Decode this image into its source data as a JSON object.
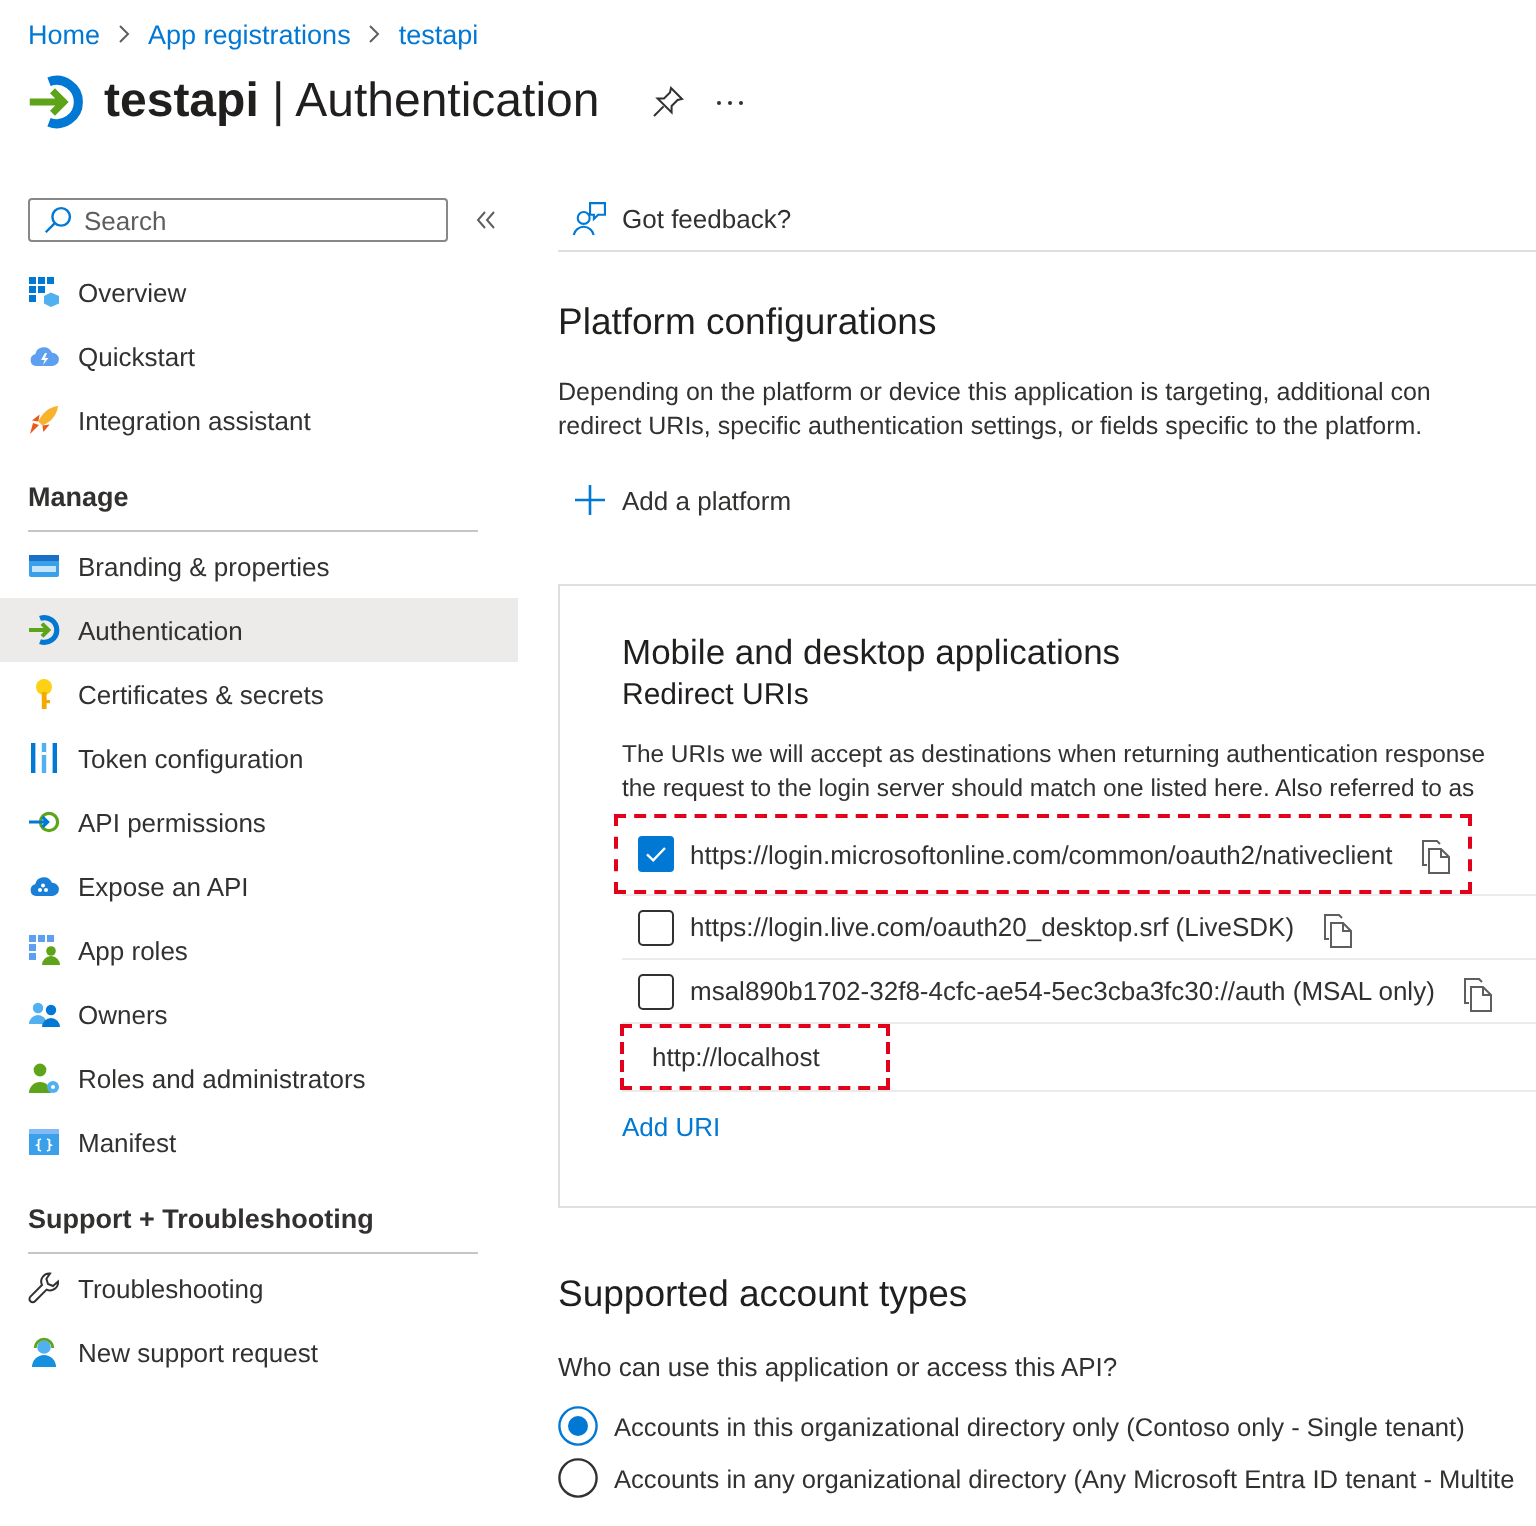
{
  "breadcrumb": [
    {
      "label": "Home"
    },
    {
      "label": "App registrations"
    },
    {
      "label": "testapi"
    }
  ],
  "page_title": "**testapi** | Authentication",
  "sidebar": {
    "search": {
      "placeholder": "Search"
    },
    "sections": [
      {
        "items": [
          {
            "label": "Overview",
            "selected": false
          },
          {
            "label": "Quickstart",
            "selected": false
          },
          {
            "label": "Integration assistant",
            "selected": false
          }
        ]
      },
      {
        "heading": "Manage",
        "items": [
          {
            "label": "Branding & properties",
            "selected": false
          },
          {
            "label": "Authentication",
            "selected": true
          },
          {
            "label": "Certificates & secrets",
            "selected": false
          },
          {
            "label": "Token configuration",
            "selected": false
          },
          {
            "label": "API permissions",
            "selected": false
          },
          {
            "label": "Expose an API",
            "selected": false
          },
          {
            "label": "App roles",
            "selected": false
          },
          {
            "label": "Owners",
            "selected": false
          },
          {
            "label": "Roles and administrators",
            "selected": false
          },
          {
            "label": "Manifest",
            "selected": false
          }
        ]
      },
      {
        "heading": "Support + Troubleshooting",
        "items": [
          {
            "label": "Troubleshooting",
            "selected": false
          },
          {
            "label": "New support request",
            "selected": false
          }
        ]
      }
    ]
  },
  "toolbar": {
    "feedback_button": "Got feedback?"
  },
  "platform_configurations": {
    "title": "Platform configurations",
    "description_lines": [
      "Depending on the platform or device this application is targeting, additional con",
      "redirect URIs, specific authentication settings, or fields specific to the platform."
    ],
    "add_button": "Add a platform",
    "card": {
      "title": "Mobile and desktop applications",
      "subtitle": "Redirect URIs",
      "description_lines": [
        "The URIs we will accept as destinations when returning authentication response",
        "the request to the login server should match one listed here. Also referred to as"
      ],
      "uris": [
        {
          "kind": "suggested",
          "text": "https://login.microsoftonline.com/common/oauth2/nativeclient",
          "checked": true,
          "highlighted": true
        },
        {
          "kind": "suggested",
          "text": "https://login.live.com/oauth20_desktop.srf (LiveSDK)",
          "checked": false,
          "highlighted": false
        },
        {
          "kind": "suggested",
          "text": "msal890b1702-32f8-4cfc-ae54-5ec3cba3fc30://auth (MSAL only)",
          "checked": false,
          "highlighted": false
        },
        {
          "kind": "custom",
          "value": "http://localhost",
          "highlighted": true
        }
      ],
      "add_link": "Add URI"
    }
  },
  "supported_account_types": {
    "title": "Supported account types",
    "question": "Who can use this application or access this API?",
    "options": [
      {
        "label": "Accounts in this organizational directory only (Contoso only - Single tenant)",
        "selected": true
      },
      {
        "label": "Accounts in any organizational directory (Any Microsoft Entra ID tenant - Multite",
        "selected": false
      }
    ]
  }
}
